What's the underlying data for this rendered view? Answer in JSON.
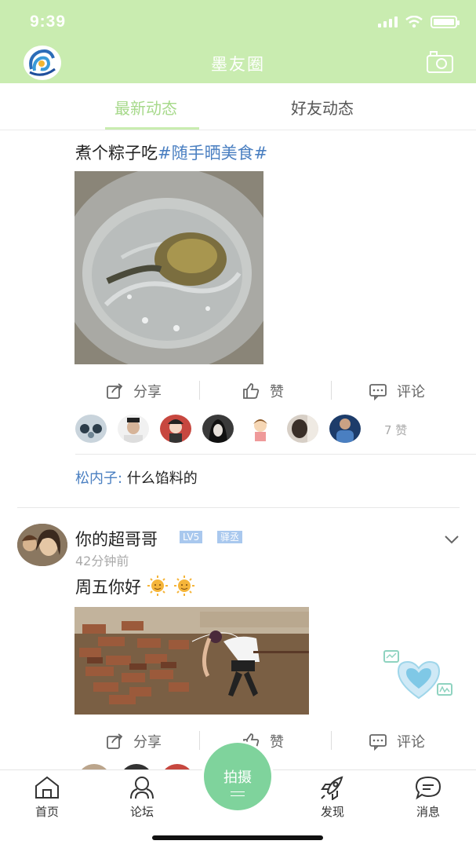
{
  "status_bar": {
    "time": "9:39"
  },
  "header": {
    "title": "墨友圈",
    "camera_icon": "camera-icon",
    "logo_icon": "app-logo"
  },
  "tabs": [
    {
      "label": "最新动态",
      "active": true
    },
    {
      "label": "好友动态",
      "active": false
    }
  ],
  "post1": {
    "text": "煮个粽子吃",
    "tag": "#随手晒美食#",
    "share_label": "分享",
    "like_label": "赞",
    "comment_label": "评论",
    "likes_count": "7 赞",
    "comment": {
      "name": "松内子:",
      "text": " 什么馅料的"
    }
  },
  "post2": {
    "user": "你的超哥哥",
    "level": "LV5",
    "role": "驿丞",
    "time": "42分钟前",
    "text": "周五你好",
    "share_label": "分享",
    "like_label": "赞",
    "comment_label": "评论"
  },
  "bottom_nav": {
    "home": "首页",
    "forum": "论坛",
    "shoot": "拍摄",
    "discover": "发现",
    "messages": "消息"
  },
  "colors": {
    "header_bg": "#c9ecb0",
    "active_tab": "#a6d98a",
    "link_blue": "#4a7fc1",
    "shoot_button": "#7fd39c"
  }
}
